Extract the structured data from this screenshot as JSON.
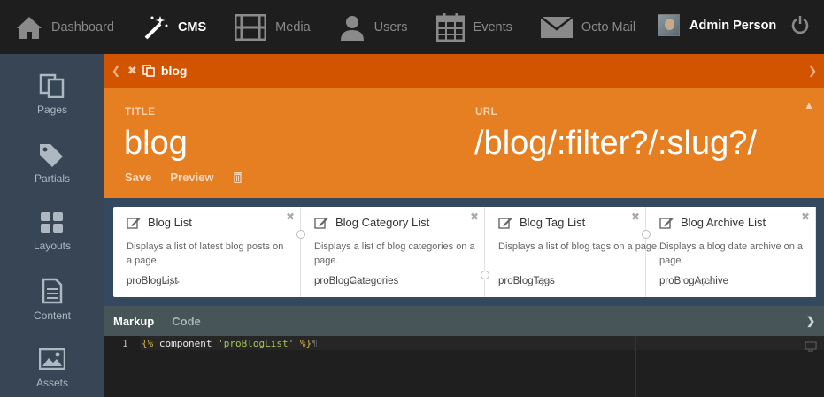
{
  "topnav": {
    "items": [
      {
        "label": "Dashboard",
        "icon": "home-icon"
      },
      {
        "label": "CMS",
        "icon": "magic-wand-icon",
        "active": true
      },
      {
        "label": "Media",
        "icon": "film-icon"
      },
      {
        "label": "Users",
        "icon": "user-icon"
      },
      {
        "label": "Events",
        "icon": "calendar-icon"
      },
      {
        "label": "Octo Mail",
        "icon": "envelope-icon"
      }
    ],
    "user_name": "Admin Person",
    "power_icon": "power-icon"
  },
  "sidebar": {
    "items": [
      {
        "label": "Pages",
        "icon": "pages-icon"
      },
      {
        "label": "Partials",
        "icon": "tags-icon"
      },
      {
        "label": "Layouts",
        "icon": "grid-icon"
      },
      {
        "label": "Content",
        "icon": "document-icon"
      },
      {
        "label": "Assets",
        "icon": "image-icon"
      }
    ]
  },
  "tabbar": {
    "active_tab": "blog"
  },
  "form": {
    "title_label": "TITLE",
    "title_value": "blog",
    "url_label": "URL",
    "url_value": "/blog/:filter?/:slug?/",
    "save_label": "Save",
    "preview_label": "Preview"
  },
  "components": [
    {
      "title": "Blog List",
      "desc": "Displays a list of latest blog posts on a page.",
      "alias": "proBlogList"
    },
    {
      "title": "Blog Category List",
      "desc": "Displays a list of blog categories on a page.",
      "alias": "proBlogCategories"
    },
    {
      "title": "Blog Tag List",
      "desc": "Displays a list of blog tags on a page.",
      "alias": "proBlogTags"
    },
    {
      "title": "Blog Archive List",
      "desc": "Displays a blog date archive on a page.",
      "alias": "proBlogArchive"
    }
  ],
  "editor": {
    "tabs": [
      "Markup",
      "Code"
    ],
    "active_tab": "Markup",
    "line_number": "1",
    "code_open": "{%",
    "code_kw": "component",
    "code_str": "'proBlogList'",
    "code_close": "%}",
    "pilcrow": "¶"
  },
  "colors": {
    "tabbar": "#d35400",
    "form_header": "#e67e22",
    "sidebar": "#374554",
    "topnav": "#1e1e1e"
  }
}
